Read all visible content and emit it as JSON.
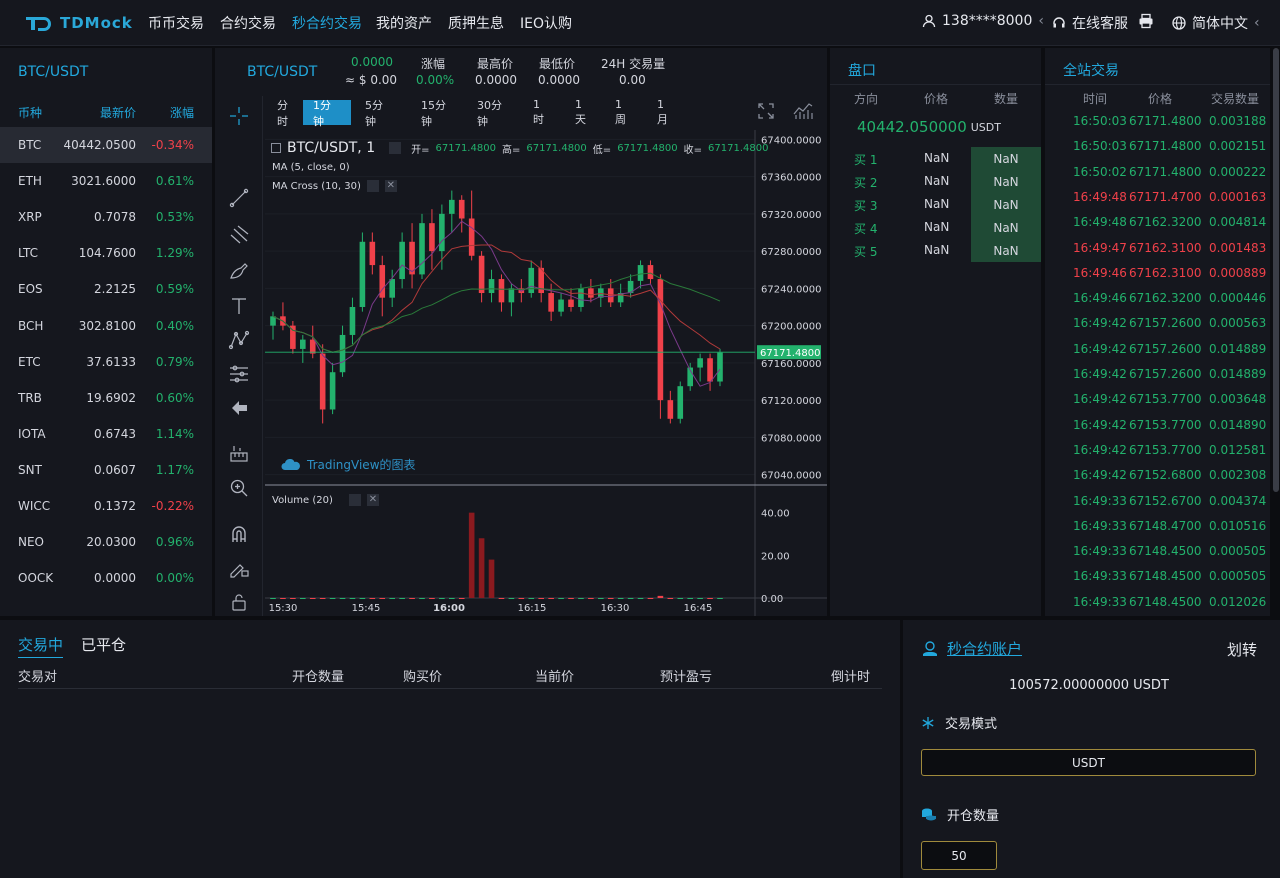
{
  "header": {
    "logo_text": "TDMock",
    "nav": [
      "币币交易",
      "合约交易",
      "秒合约交易",
      "我的资产",
      "质押生息",
      "IEO认购"
    ],
    "active_nav": 2,
    "user": "138****8000",
    "support": "在线客服",
    "language": "简体中文"
  },
  "market": {
    "title": "BTC/USDT",
    "headers": [
      "币种",
      "最新价",
      "涨幅"
    ],
    "rows": [
      {
        "sym": "BTC",
        "price": "40442.0500",
        "chg": "-0.34%",
        "up": false
      },
      {
        "sym": "ETH",
        "price": "3021.6000",
        "chg": "0.61%",
        "up": true
      },
      {
        "sym": "XRP",
        "price": "0.7078",
        "chg": "0.53%",
        "up": true
      },
      {
        "sym": "LTC",
        "price": "104.7600",
        "chg": "1.29%",
        "up": true
      },
      {
        "sym": "EOS",
        "price": "2.2125",
        "chg": "0.59%",
        "up": true
      },
      {
        "sym": "BCH",
        "price": "302.8100",
        "chg": "0.40%",
        "up": true
      },
      {
        "sym": "ETC",
        "price": "37.6133",
        "chg": "0.79%",
        "up": true
      },
      {
        "sym": "TRB",
        "price": "19.6902",
        "chg": "0.60%",
        "up": true
      },
      {
        "sym": "IOTA",
        "price": "0.6743",
        "chg": "1.14%",
        "up": true
      },
      {
        "sym": "SNT",
        "price": "0.0607",
        "chg": "1.17%",
        "up": true
      },
      {
        "sym": "WICC",
        "price": "0.1372",
        "chg": "-0.22%",
        "up": false
      },
      {
        "sym": "NEO",
        "price": "20.0300",
        "chg": "0.96%",
        "up": true
      },
      {
        "sym": "OOCK",
        "price": "0.0000",
        "chg": "0.00%",
        "up": true
      }
    ]
  },
  "ticker": {
    "pair": "BTC/USDT",
    "price": "0.0000",
    "usd": "≈ $ 0.00",
    "change_label": "涨幅",
    "change": "0.00%",
    "high_label": "最高价",
    "high": "0.0000",
    "low_label": "最低价",
    "low": "0.0000",
    "vol_label": "24H 交易量",
    "vol": "0.00"
  },
  "chart": {
    "timeframes": [
      "分时",
      "1分钟",
      "5分钟",
      "15分钟",
      "30分钟",
      "1时",
      "1天",
      "1周",
      "1月"
    ],
    "active_tf": 1,
    "symbol": "BTC/USDT, 1",
    "ohlc": {
      "o_label": "开=",
      "o": "67171.4800",
      "h_label": "高=",
      "h": "67171.4800",
      "l_label": "低=",
      "l": "67171.4800",
      "c_label": "收=",
      "c": "67171.4800"
    },
    "ma_label": "MA (5, close, 0)",
    "macross_label": "MA Cross (10, 30)",
    "watermark": "TradingView的图表",
    "volume_label": "Volume (20)",
    "last_price": "67171.4800",
    "price_ticks": [
      "67400.0000",
      "67360.0000",
      "67320.0000",
      "67280.0000",
      "67240.0000",
      "67200.0000",
      "67160.0000",
      "67120.0000",
      "67080.0000",
      "67040.0000"
    ],
    "volume_ticks": [
      "40.00",
      "20.00",
      "0.00"
    ],
    "time_ticks": [
      "15:30",
      "15:45",
      "16:00",
      "16:15",
      "16:30",
      "16:45"
    ],
    "colors": {
      "up": "#23b26d",
      "down": "#f0414a",
      "accent": "#22a8dd"
    }
  },
  "chart_data": {
    "type": "candlestick",
    "ylim": [
      67030,
      67410
    ],
    "candles": [
      [
        67200,
        67215,
        67185,
        67210
      ],
      [
        67210,
        67225,
        67195,
        67200
      ],
      [
        67200,
        67205,
        67170,
        67175
      ],
      [
        67175,
        67190,
        67160,
        67185
      ],
      [
        67185,
        67200,
        67165,
        67170
      ],
      [
        67170,
        67180,
        67095,
        67110
      ],
      [
        67110,
        67160,
        67105,
        67150
      ],
      [
        67150,
        67200,
        67145,
        67190
      ],
      [
        67190,
        67230,
        67180,
        67220
      ],
      [
        67220,
        67300,
        67215,
        67290
      ],
      [
        67290,
        67300,
        67255,
        67265
      ],
      [
        67265,
        67275,
        67210,
        67230
      ],
      [
        67230,
        67260,
        67220,
        67250
      ],
      [
        67250,
        67300,
        67240,
        67290
      ],
      [
        67290,
        67310,
        67240,
        67255
      ],
      [
        67255,
        67320,
        67250,
        67310
      ],
      [
        67310,
        67325,
        67260,
        67280
      ],
      [
        67280,
        67330,
        67260,
        67320
      ],
      [
        67320,
        67345,
        67300,
        67335
      ],
      [
        67335,
        67340,
        67300,
        67315
      ],
      [
        67315,
        67345,
        67270,
        67275
      ],
      [
        67275,
        67280,
        67225,
        67235
      ],
      [
        67235,
        67260,
        67225,
        67250
      ],
      [
        67250,
        67255,
        67215,
        67225
      ],
      [
        67225,
        67245,
        67210,
        67240
      ],
      [
        67240,
        67250,
        67225,
        67235
      ],
      [
        67235,
        67270,
        67230,
        67262
      ],
      [
        67262,
        67270,
        67225,
        67235
      ],
      [
        67235,
        67245,
        67205,
        67215
      ],
      [
        67215,
        67235,
        67210,
        67228
      ],
      [
        67228,
        67240,
        67215,
        67220
      ],
      [
        67220,
        67245,
        67215,
        67240
      ],
      [
        67240,
        67250,
        67225,
        67230
      ],
      [
        67230,
        67245,
        67220,
        67240
      ],
      [
        67240,
        67250,
        67220,
        67225
      ],
      [
        67225,
        67245,
        67220,
        67235
      ],
      [
        67235,
        67255,
        67230,
        67248
      ],
      [
        67248,
        67270,
        67240,
        67265
      ],
      [
        67265,
        67270,
        67245,
        67250
      ],
      [
        67250,
        67255,
        67100,
        67120
      ],
      [
        67120,
        67130,
        67095,
        67100
      ],
      [
        67100,
        67140,
        67095,
        67135
      ],
      [
        67135,
        67160,
        67130,
        67155
      ],
      [
        67155,
        67170,
        67140,
        67165
      ],
      [
        67165,
        67170,
        67130,
        67140
      ],
      [
        67140,
        67175,
        67135,
        67171
      ]
    ],
    "volume": [
      0,
      0,
      0,
      0,
      0,
      0,
      0,
      0,
      0,
      0,
      0,
      0,
      0,
      0,
      0,
      0,
      0,
      0,
      0,
      0,
      40,
      28,
      18,
      0,
      0,
      0,
      0,
      0,
      0,
      0,
      0,
      0,
      0,
      0,
      0,
      0,
      0,
      0,
      0,
      1,
      0,
      0,
      0,
      0,
      0,
      0
    ],
    "volume_ylim": [
      0,
      45
    ]
  },
  "orderbook": {
    "title": "盘口",
    "headers": [
      "方向",
      "价格",
      "数量"
    ],
    "mid_price": "40442.050000",
    "mid_unit": "USDT",
    "rows": [
      {
        "side": "买 1",
        "price": "NaN",
        "qty": "NaN"
      },
      {
        "side": "买 2",
        "price": "NaN",
        "qty": "NaN"
      },
      {
        "side": "买 3",
        "price": "NaN",
        "qty": "NaN"
      },
      {
        "side": "买 4",
        "price": "NaN",
        "qty": "NaN"
      },
      {
        "side": "买 5",
        "price": "NaN",
        "qty": "NaN"
      }
    ]
  },
  "trades": {
    "title": "全站交易",
    "headers": [
      "时间",
      "价格",
      "交易数量"
    ],
    "rows": [
      {
        "t": "16:50:03",
        "p": "67171.4800",
        "q": "0.003188",
        "up": true
      },
      {
        "t": "16:50:03",
        "p": "67171.4800",
        "q": "0.002151",
        "up": true
      },
      {
        "t": "16:50:02",
        "p": "67171.4800",
        "q": "0.000222",
        "up": true
      },
      {
        "t": "16:49:48",
        "p": "67171.4700",
        "q": "0.000163",
        "up": false
      },
      {
        "t": "16:49:48",
        "p": "67162.3200",
        "q": "0.004814",
        "up": true
      },
      {
        "t": "16:49:47",
        "p": "67162.3100",
        "q": "0.001483",
        "up": false
      },
      {
        "t": "16:49:46",
        "p": "67162.3100",
        "q": "0.000889",
        "up": false
      },
      {
        "t": "16:49:46",
        "p": "67162.3200",
        "q": "0.000446",
        "up": true
      },
      {
        "t": "16:49:42",
        "p": "67157.2600",
        "q": "0.000563",
        "up": true
      },
      {
        "t": "16:49:42",
        "p": "67157.2600",
        "q": "0.014889",
        "up": true
      },
      {
        "t": "16:49:42",
        "p": "67157.2600",
        "q": "0.014889",
        "up": true
      },
      {
        "t": "16:49:42",
        "p": "67153.7700",
        "q": "0.003648",
        "up": true
      },
      {
        "t": "16:49:42",
        "p": "67153.7700",
        "q": "0.014890",
        "up": true
      },
      {
        "t": "16:49:42",
        "p": "67153.7700",
        "q": "0.012581",
        "up": true
      },
      {
        "t": "16:49:42",
        "p": "67152.6800",
        "q": "0.002308",
        "up": true
      },
      {
        "t": "16:49:33",
        "p": "67152.6700",
        "q": "0.004374",
        "up": true
      },
      {
        "t": "16:49:33",
        "p": "67148.4700",
        "q": "0.010516",
        "up": true
      },
      {
        "t": "16:49:33",
        "p": "67148.4500",
        "q": "0.000505",
        "up": true
      },
      {
        "t": "16:49:33",
        "p": "67148.4500",
        "q": "0.000505",
        "up": true
      },
      {
        "t": "16:49:33",
        "p": "67148.4500",
        "q": "0.012026",
        "up": true
      }
    ]
  },
  "orders": {
    "tab_active": "交易中",
    "tab_closed": "已平仓",
    "columns": [
      "交易对",
      "开仓数量",
      "购买价",
      "当前价",
      "预计盈亏",
      "倒计时"
    ]
  },
  "account": {
    "title": "秒合约账户",
    "transfer": "划转",
    "balance": "100572.00000000 USDT",
    "mode_label": "交易模式",
    "mode_value": "USDT",
    "qty_label": "开仓数量",
    "qty_value": "50"
  }
}
